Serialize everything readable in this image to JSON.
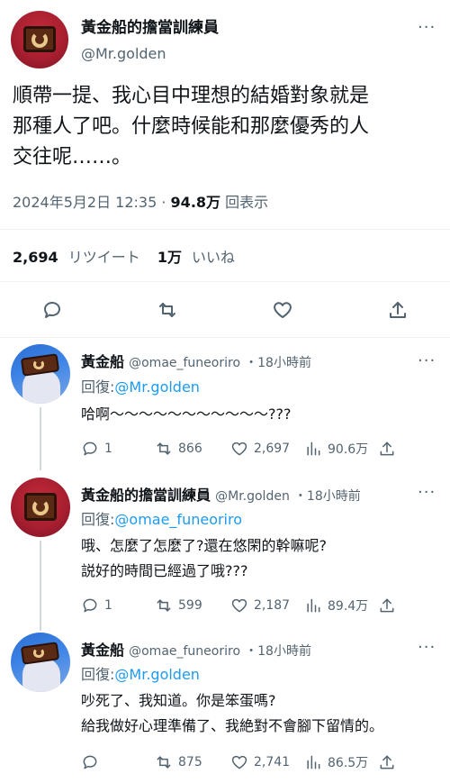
{
  "main_tweet": {
    "author_name": "黃金船的擔當訓練員",
    "author_handle": "@Mr.golden",
    "more": "···",
    "text_lines": [
      "順帶一提、我心目中理想的結婚對象就是",
      "那種人了吧。什麼時候能和那麼優秀的人",
      "交往呢……。"
    ],
    "date": "2024年5月2日 12:35",
    "views_count": "94.8万",
    "views_label": "回表示",
    "retweet_count": "2,694",
    "retweet_label": "リツイート",
    "like_count": "1万",
    "like_label": "いいね"
  },
  "replies": [
    {
      "author_name": "黃金船",
      "author_handle": "@omae_funeoriro",
      "time": "・18小時前",
      "reply_prefix": "回復:",
      "reply_to": "@Mr.golden",
      "text_lines": [
        "哈啊～～～～～～～～～～～???"
      ],
      "replies": "1",
      "retweets": "866",
      "likes": "2,697",
      "views": "90.6万"
    },
    {
      "author_name": "黃金船的擔當訓練員",
      "author_handle": "@Mr.golden",
      "time": "・18小時前",
      "reply_prefix": "回復:",
      "reply_to": "@omae_funeoriro",
      "text_lines": [
        "哦、怎麼了怎麼了?還在悠閑的幹嘛呢?",
        "説好的時間已經過了哦???"
      ],
      "replies": "1",
      "retweets": "599",
      "likes": "2,187",
      "views": "89.4万"
    },
    {
      "author_name": "黃金船",
      "author_handle": "@omae_funeoriro",
      "time": "・18小時前",
      "reply_prefix": "回復:",
      "reply_to": "@Mr.golden",
      "text_lines": [
        "吵死了、我知道。你是笨蛋嗎?",
        "給我做好心理準備了、我絶對不會腳下留情的。"
      ],
      "replies": "",
      "retweets": "875",
      "likes": "2,741",
      "views": "86.5万"
    }
  ],
  "icons": [
    "reply-icon",
    "retweet-icon",
    "like-icon",
    "views-icon",
    "share-icon"
  ]
}
